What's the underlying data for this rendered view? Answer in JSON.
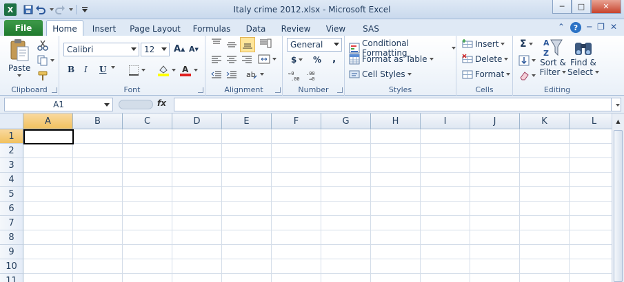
{
  "window": {
    "title": "Italy crime 2012.xlsx  -  Microsoft Excel",
    "app_icon": "X",
    "qat": {
      "save": "save-icon",
      "undo": "undo-icon",
      "redo": "redo-icon",
      "customize": "customize-qat-icon"
    },
    "controls": {
      "minimize": "─",
      "maximize": "□",
      "close": "✕"
    }
  },
  "tabs": {
    "file": "File",
    "items": [
      "Home",
      "Insert",
      "Page Layout",
      "Formulas",
      "Data",
      "Review",
      "View",
      "SAS"
    ],
    "active": "Home"
  },
  "ribbon": {
    "clipboard": {
      "paste": "Paste",
      "label": "Clipboard"
    },
    "font": {
      "name": "Calibri",
      "size": "12",
      "bold": "B",
      "italic": "I",
      "underline": "U",
      "label": "Font"
    },
    "alignment": {
      "label": "Alignment"
    },
    "number": {
      "format": "General",
      "currency": "$",
      "percent": "%",
      "comma": ",",
      "label": "Number"
    },
    "styles": {
      "conditional": "Conditional Formatting",
      "table": "Format as Table",
      "cell_styles": "Cell Styles",
      "label": "Styles"
    },
    "cells": {
      "insert": "Insert",
      "delete": "Delete",
      "format": "Format",
      "label": "Cells"
    },
    "editing": {
      "sum": "Σ",
      "sort_1": "Sort &",
      "sort_2": "Filter",
      "find_1": "Find &",
      "find_2": "Select",
      "label": "Editing"
    }
  },
  "formula_bar": {
    "name_box": "A1",
    "fx": "fx",
    "formula": ""
  },
  "sheet": {
    "columns": [
      "A",
      "B",
      "C",
      "D",
      "E",
      "F",
      "G",
      "H",
      "I",
      "J",
      "K",
      "L"
    ],
    "rows": [
      "1",
      "2",
      "3",
      "4",
      "5",
      "6",
      "7",
      "8",
      "9",
      "10",
      "11"
    ],
    "active_cell": "A1"
  }
}
